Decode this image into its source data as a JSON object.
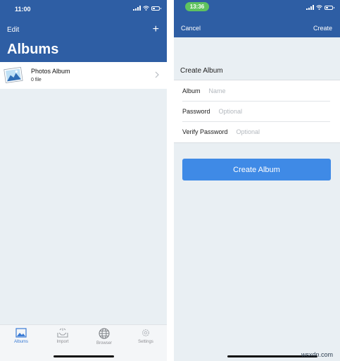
{
  "left": {
    "status_time": "11:00",
    "edit_label": "Edit",
    "add_symbol": "+",
    "title": "Albums",
    "albums": [
      {
        "name": "Photos Album",
        "count": "0 file",
        "icon": "photo-icon"
      }
    ],
    "tabs": [
      {
        "label": "Albums",
        "icon": "albums-icon",
        "active": true
      },
      {
        "label": "Import",
        "icon": "import-icon",
        "active": false
      },
      {
        "label": "Browser",
        "icon": "globe-icon",
        "active": false
      },
      {
        "label": "Settings",
        "icon": "gear-icon",
        "active": false
      }
    ]
  },
  "right": {
    "status_time": "13:36",
    "cancel_label": "Cancel",
    "create_label": "Create",
    "section_title": "Create Album",
    "fields": [
      {
        "label": "Album",
        "placeholder": "Name"
      },
      {
        "label": "Password",
        "placeholder": "Optional"
      },
      {
        "label": "Verify Password",
        "placeholder": "Optional"
      }
    ],
    "submit_label": "Create Album"
  },
  "watermark": "wsxdn.com",
  "colors": {
    "header_blue": "#2e5ea4",
    "button_blue": "#3f8ae6",
    "tab_active": "#3a7bd5",
    "background": "#e9eff3",
    "time_pill_green": "#5fc25f"
  }
}
